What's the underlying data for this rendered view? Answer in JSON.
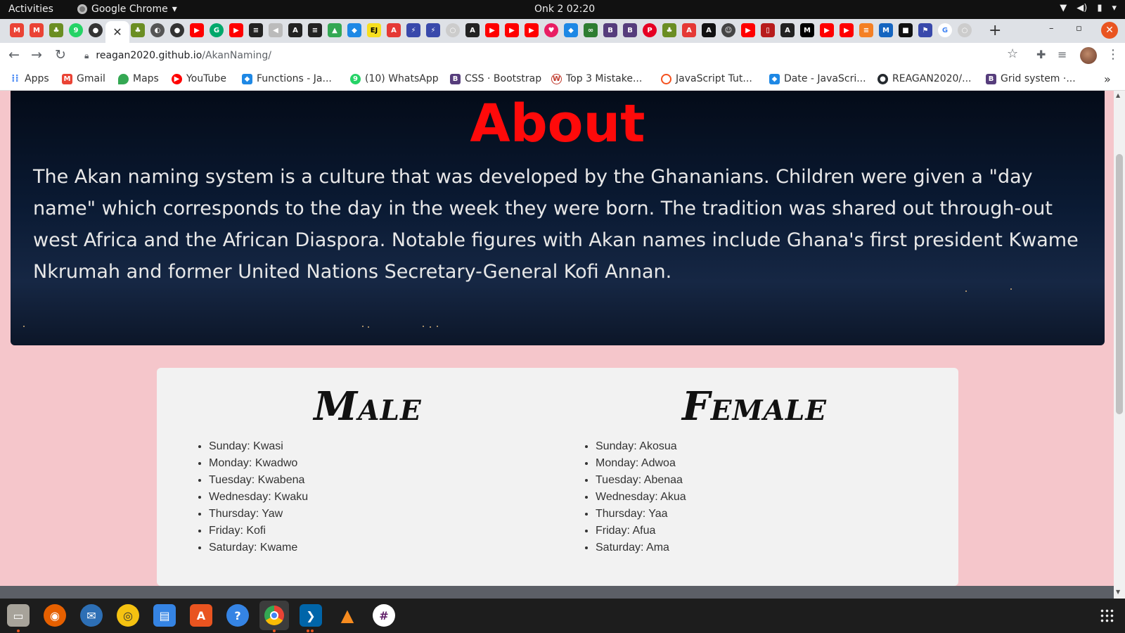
{
  "system": {
    "activities": "Activities",
    "app_name": "Google Chrome",
    "clock": "Onk 2  02:20"
  },
  "browser": {
    "url_host": "reagan2020.github.io",
    "url_path": "/AkanNaming/",
    "bookmarks": [
      {
        "label": "Apps",
        "icon": "apps-grid-icon",
        "color": "#4285f4"
      },
      {
        "label": "Gmail",
        "icon": "gmail-icon",
        "color": "#ea4335"
      },
      {
        "label": "Maps",
        "icon": "maps-icon",
        "color": "#34a853"
      },
      {
        "label": "YouTube",
        "icon": "youtube-icon",
        "color": "#ff0000"
      },
      {
        "label": "Functions - Ja...",
        "icon": "graduation-cap-icon",
        "color": "#1e88e5"
      },
      {
        "label": "(10) WhatsApp",
        "icon": "whatsapp-icon",
        "color": "#25d366"
      },
      {
        "label": "CSS · Bootstrap",
        "icon": "bootstrap-icon",
        "color": "#563d7c"
      },
      {
        "label": "Top 3 Mistake...",
        "icon": "w-logo-icon",
        "color": "#c0392b"
      },
      {
        "label": "JavaScript Tut...",
        "icon": "spiral-icon",
        "color": "#f4511e"
      },
      {
        "label": "Date - JavaScri...",
        "icon": "graduation-cap-icon",
        "color": "#1e88e5"
      },
      {
        "label": "REAGAN2020/...",
        "icon": "github-icon",
        "color": "#24292e"
      },
      {
        "label": "Grid system ·...",
        "icon": "bootstrap-icon",
        "color": "#563d7c"
      }
    ]
  },
  "about": {
    "title": "About",
    "text": "The Akan naming system is a culture that was developed by the Ghananians. Children were given a \"day name\" which corresponds to the day in the week they were born. The tradition was shared out through-out west Africa and the African Diaspora. Notable figures with Akan names include Ghana's first president Kwame Nkrumah and former United Nations Secretary-General Kofi Annan."
  },
  "names": {
    "male": {
      "title": "Male",
      "items": [
        "Sunday: Kwasi",
        "Monday: Kwadwo",
        "Tuesday: Kwabena",
        "Wednesday: Kwaku",
        "Thursday: Yaw",
        "Friday: Kofi",
        "Saturday: Kwame"
      ]
    },
    "female": {
      "title": "Female",
      "items": [
        "Sunday: Akosua",
        "Monday: Adwoa",
        "Tuesday: Abenaa",
        "Wednesday: Akua",
        "Thursday: Yaa",
        "Friday: Afua",
        "Saturday: Ama"
      ]
    }
  },
  "colors": {
    "page_bg": "#f5c6cb",
    "about_title": "#ff0a0a",
    "ubuntu_orange": "#e95420"
  }
}
